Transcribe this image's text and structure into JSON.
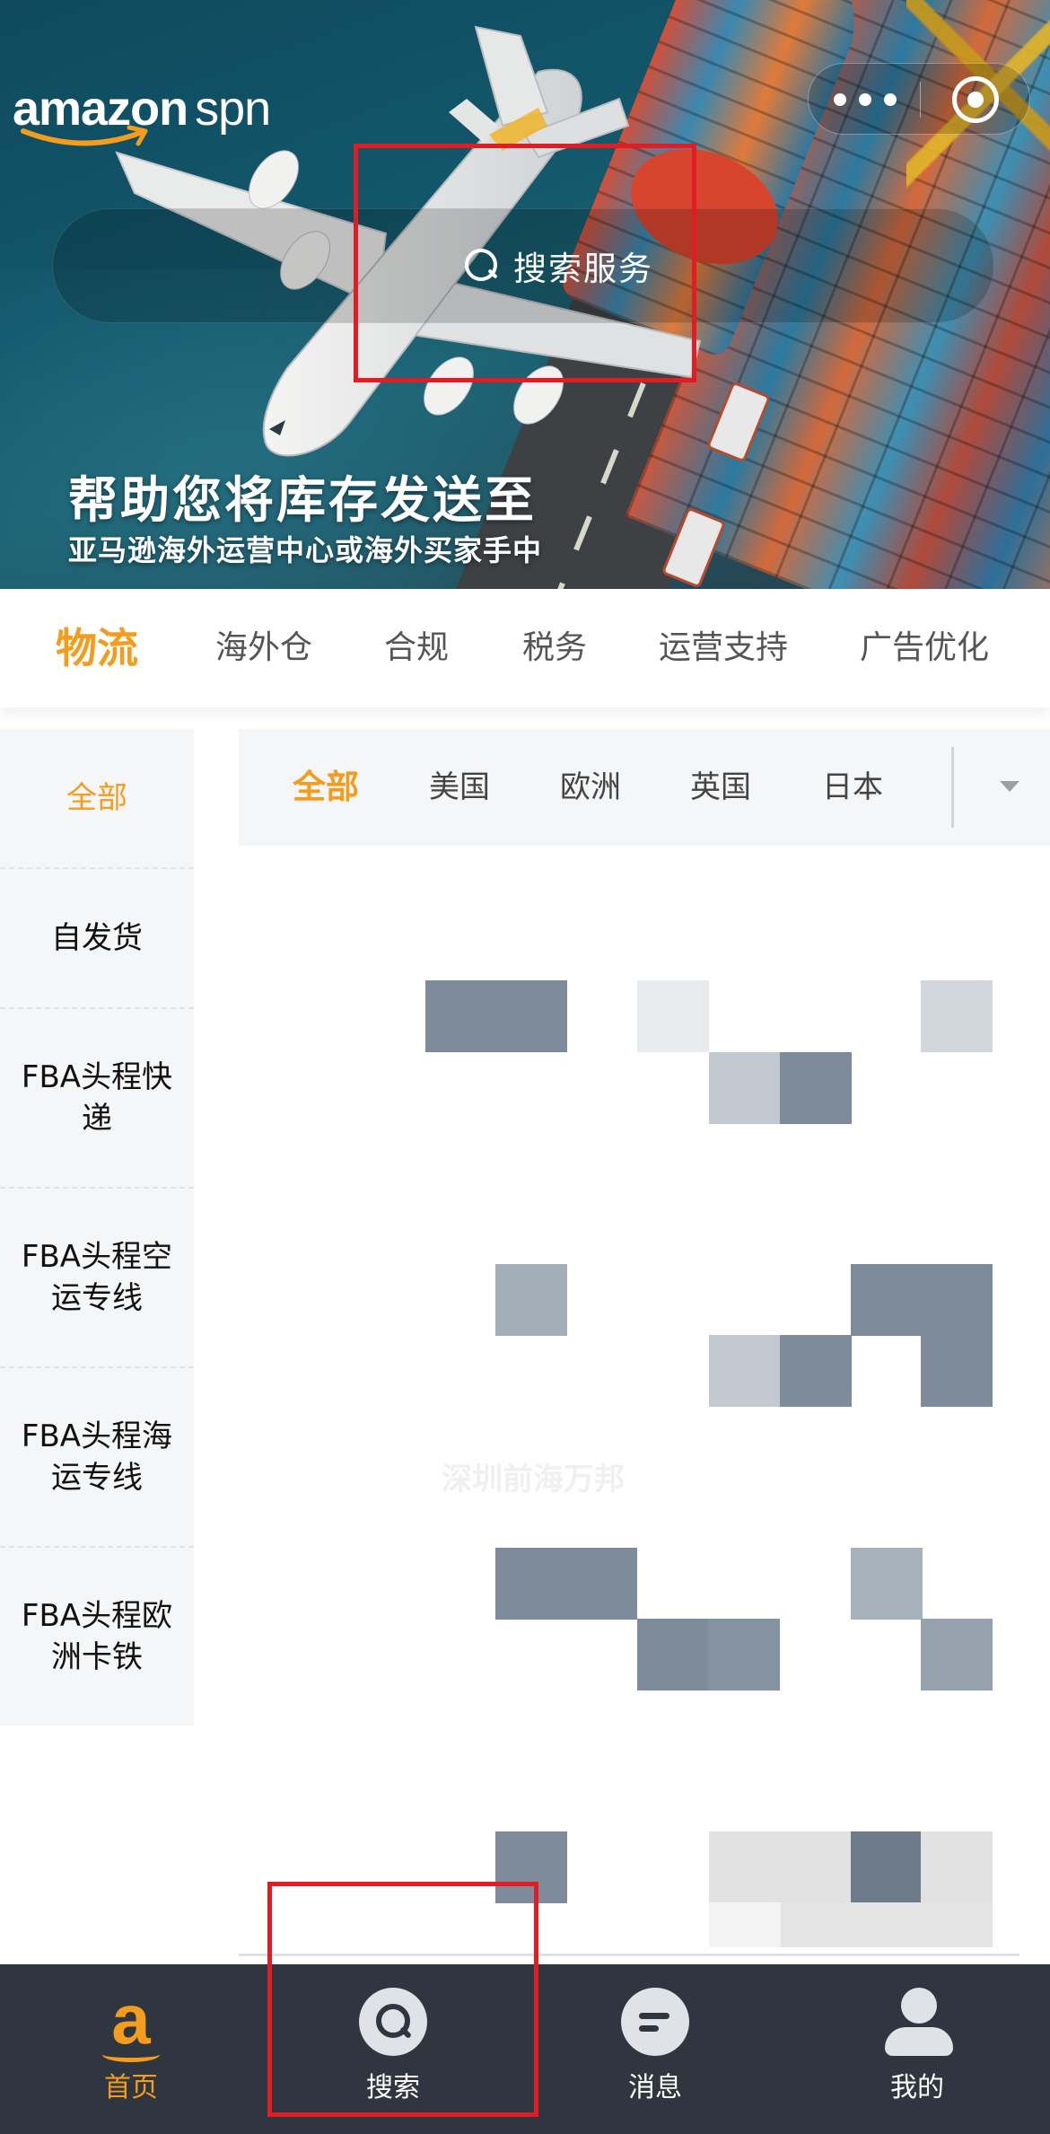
{
  "brand": {
    "logo_main": "amazon",
    "logo_sub": "spn"
  },
  "header": {
    "more_icon": "ellipsis-icon",
    "target_icon": "target-icon"
  },
  "search": {
    "placeholder": "搜索服务",
    "icon": "search-icon"
  },
  "banner": {
    "title": "帮助您将库存发送至",
    "subtitle": "亚马逊海外运营中心或海外买家手中"
  },
  "category_tabs": [
    {
      "label": "物流",
      "active": true
    },
    {
      "label": "海外仓",
      "active": false
    },
    {
      "label": "合规",
      "active": false
    },
    {
      "label": "税务",
      "active": false
    },
    {
      "label": "运营支持",
      "active": false
    },
    {
      "label": "广告优化",
      "active": false
    }
  ],
  "sidebar": {
    "items": [
      {
        "label": "全部",
        "active": true
      },
      {
        "label": "自发货",
        "active": false
      },
      {
        "label": "FBA头程快\n递",
        "active": false
      },
      {
        "label": "FBA头程空\n运专线",
        "active": false
      },
      {
        "label": "FBA头程海\n运专线",
        "active": false
      },
      {
        "label": "FBA头程欧\n洲卡铁",
        "active": false
      }
    ]
  },
  "region_tabs": [
    {
      "label": "全部",
      "active": true
    },
    {
      "label": "美国",
      "active": false
    },
    {
      "label": "欧洲",
      "active": false
    },
    {
      "label": "英国",
      "active": false
    },
    {
      "label": "日本",
      "active": false
    }
  ],
  "region_dropdown_icon": "chevron-down-icon",
  "content": {
    "faint_provider": "深圳前海万邦"
  },
  "bottom_nav": [
    {
      "label": "首页",
      "icon": "amazon-a-icon",
      "active": true
    },
    {
      "label": "搜索",
      "icon": "search-icon",
      "active": false
    },
    {
      "label": "消息",
      "icon": "message-icon",
      "active": false
    },
    {
      "label": "我的",
      "icon": "user-icon",
      "active": false
    }
  ],
  "colors": {
    "accent": "#f39c1e",
    "annotation": "#e21c24",
    "nav_bg": "#2f3640",
    "sidebar_bg": "#f5f6f7"
  }
}
